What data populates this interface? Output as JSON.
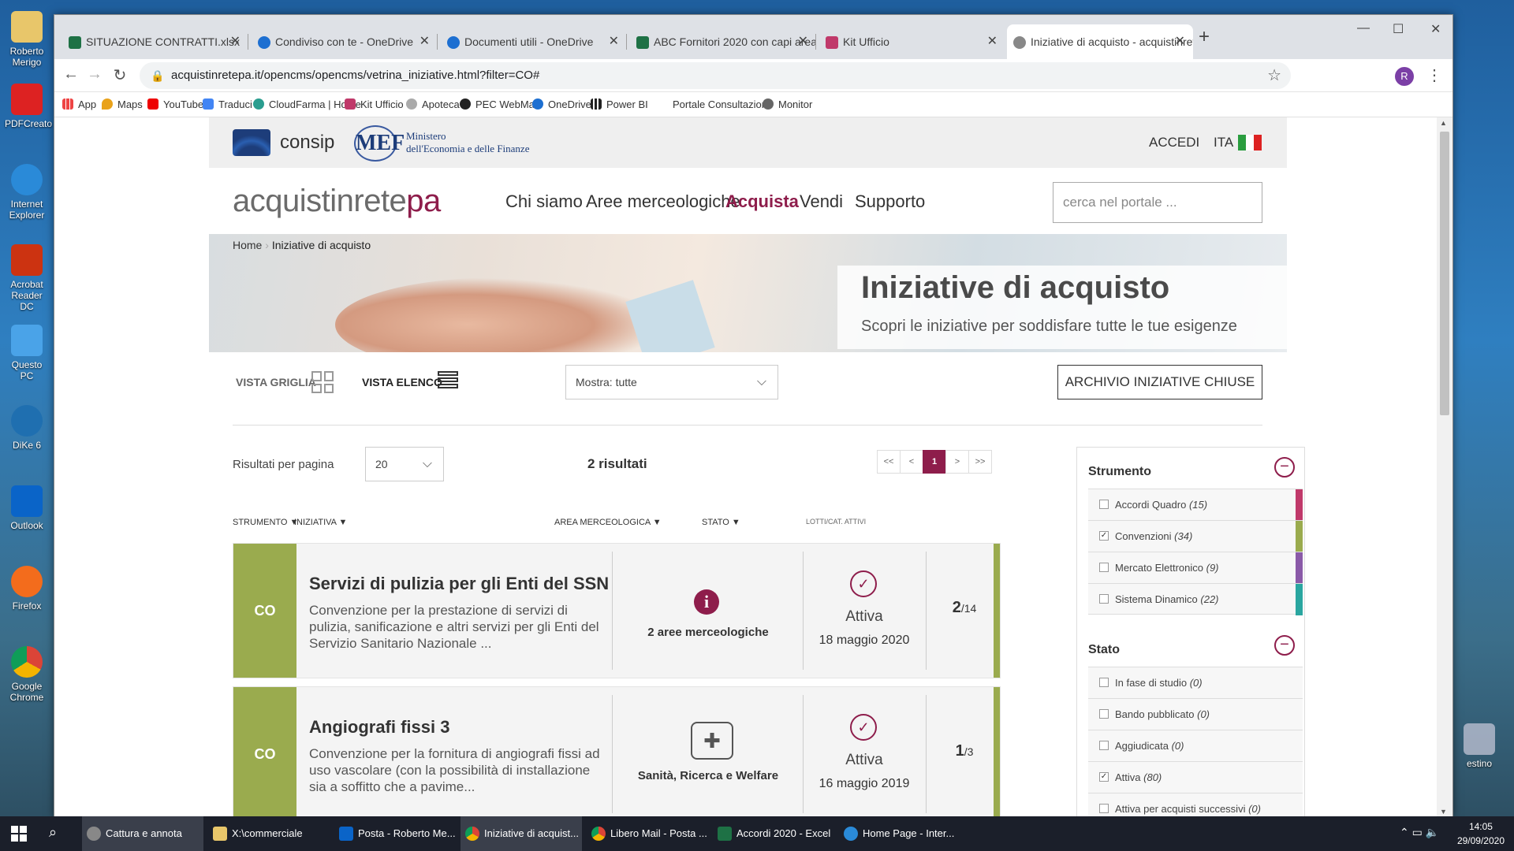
{
  "desktop": {
    "icons": [
      "Roberto Merigo",
      "PDFCreato",
      "Internet Explorer",
      "Acrobat Reader DC",
      "Questo PC",
      "DiKe 6",
      "Outlook",
      "Firefox",
      "Google Chrome"
    ],
    "right_icon": "estino"
  },
  "browser": {
    "tabs": [
      {
        "label": "SITUAZIONE CONTRATTI.xlsx",
        "icon": "excel-icon"
      },
      {
        "label": "Condiviso con te - OneDrive",
        "icon": "onedrive-icon"
      },
      {
        "label": "Documenti utili - OneDrive",
        "icon": "onedrive-icon"
      },
      {
        "label": "ABC Fornitori 2020 con capi area",
        "icon": "excel-icon"
      },
      {
        "label": "Kit Ufficio",
        "icon": "kit-icon"
      },
      {
        "label": "Iniziative di acquisto - acquistinrete",
        "icon": "globe-icon"
      }
    ],
    "url": "acquistinretepa.it/opencms/opencms/vetrina_iniziative.html?filter=CO#",
    "profile_initial": "R",
    "bookmarks": [
      "App",
      "Maps",
      "YouTube",
      "Traduci",
      "CloudFarma | Home",
      "Kit Ufficio",
      "Apoteca",
      "PEC WebMail",
      "OneDrive",
      "Power BI",
      "Portale Consultazioni",
      "Monitor"
    ]
  },
  "site": {
    "header": {
      "consip": "consip",
      "mef_logo": "MEF",
      "mef_line1": "Ministero",
      "mef_line2": "dell'Economia e delle Finanze",
      "accedi": "ACCEDI",
      "lang": "ITA"
    },
    "brand_part1": "acquistinrete",
    "brand_part2": "pa",
    "menu": [
      "Chi siamo",
      "Aree merceologiche",
      "Acquista",
      "Vendi",
      "Supporto"
    ],
    "search_placeholder": "cerca nel portale ...",
    "breadcrumb": {
      "home": "Home",
      "current": "Iniziative di acquisto"
    },
    "hero": {
      "title": "Iniziative di acquisto",
      "subtitle": "Scopri le iniziative per soddisfare tutte le tue esigenze"
    },
    "controls": {
      "vista_griglia": "VISTA GRIGLIA",
      "vista_elenco": "VISTA ELENCO",
      "mostra": "Mostra: tutte",
      "archivio": "ARCHIVIO INIZIATIVE CHIUSE",
      "rpp_label": "Risultati per pagina",
      "rpp_value": "20",
      "results": "2 risultati",
      "pager": [
        "<<",
        "<",
        "1",
        ">",
        ">>"
      ]
    },
    "table_headers": [
      "STRUMENTO",
      "INIZIATIVA",
      "AREA MERCEOLOGICA",
      "STATO",
      "LOTTI/CAT. ATTIVI"
    ],
    "rows": [
      {
        "strumento": "CO",
        "title": "Servizi di pulizia per gli Enti del SSN",
        "desc": "Convenzione per la prestazione di servizi di pulizia, sanificazione e altri servizi per gli Enti del Servizio Sanitario Nazionale ...",
        "area": "2 aree merceologiche",
        "area_icon": "info-icon",
        "stato": "Attiva",
        "data": "18 maggio 2020",
        "lotti": "2",
        "lotti_tot": "/14"
      },
      {
        "strumento": "CO",
        "title": "Angiografi fissi 3",
        "desc": "Convenzione per la fornitura di angiografi fissi ad uso vascolare (con la possibilità di installazione sia a soffitto che a pavime...",
        "area": "Sanità, Ricerca e Welfare",
        "area_icon": "medical-icon",
        "stato": "Attiva",
        "data": "16 maggio 2019",
        "lotti": "1",
        "lotti_tot": "/3"
      }
    ],
    "filters": {
      "strumento_title": "Strumento",
      "strumento": [
        {
          "label": "Accordi Quadro",
          "count": "(15)",
          "checked": false,
          "color": "#c0396a"
        },
        {
          "label": "Convenzioni",
          "count": "(34)",
          "checked": true,
          "color": "#9aab4e"
        },
        {
          "label": "Mercato Elettronico",
          "count": "(9)",
          "checked": false,
          "color": "#8a5aa8"
        },
        {
          "label": "Sistema Dinamico",
          "count": "(22)",
          "checked": false,
          "color": "#2aa6a0"
        }
      ],
      "stato_title": "Stato",
      "stato": [
        {
          "label": "In fase di studio",
          "count": "(0)",
          "checked": false
        },
        {
          "label": "Bando pubblicato",
          "count": "(0)",
          "checked": false
        },
        {
          "label": "Aggiudicata",
          "count": "(0)",
          "checked": false
        },
        {
          "label": "Attiva",
          "count": "(80)",
          "checked": true
        },
        {
          "label": "Attiva per acquisti successivi",
          "count": "(0)",
          "checked": false
        }
      ]
    }
  },
  "taskbar": {
    "items": [
      "Cattura e annota",
      "X:\\commerciale",
      "Posta - Roberto Me...",
      "Iniziative di acquist...",
      "Libero Mail - Posta ...",
      "Accordi 2020 - Excel",
      "Home Page - Inter..."
    ],
    "time": "14:05",
    "date": "29/09/2020"
  }
}
